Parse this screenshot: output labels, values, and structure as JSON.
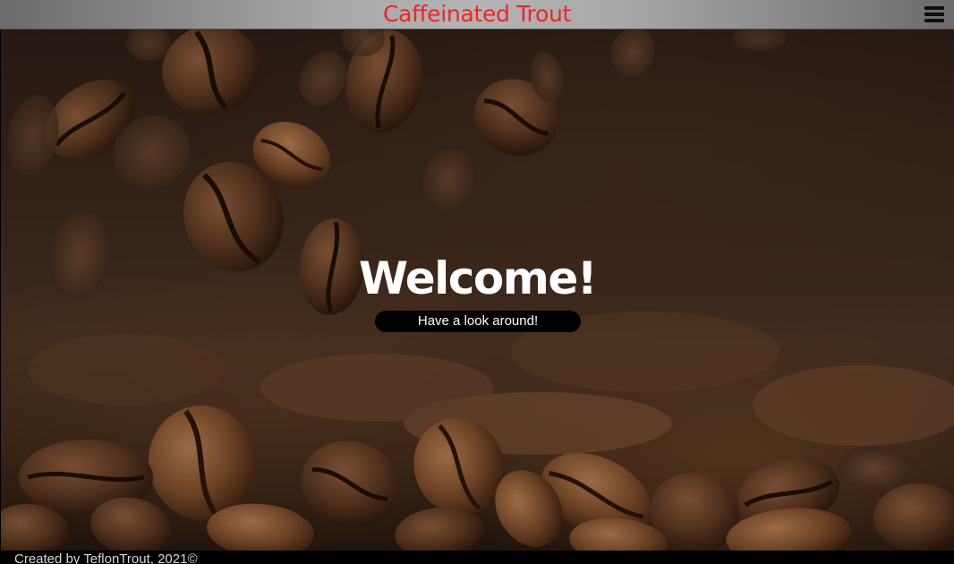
{
  "header": {
    "title": "Caffeinated Trout",
    "menu_icon": "hamburger-menu-icon"
  },
  "hero": {
    "background_image": "falling-coffee-beans",
    "heading": "Welcome!",
    "button_label": "Have a look around!"
  },
  "footer": {
    "text": "Created by TeflonTrout, 2021©"
  },
  "colors": {
    "title": "#e8282b",
    "header_bg": "#a8a8a8",
    "button_bg": "#000000",
    "footer_bg": "#000000"
  }
}
